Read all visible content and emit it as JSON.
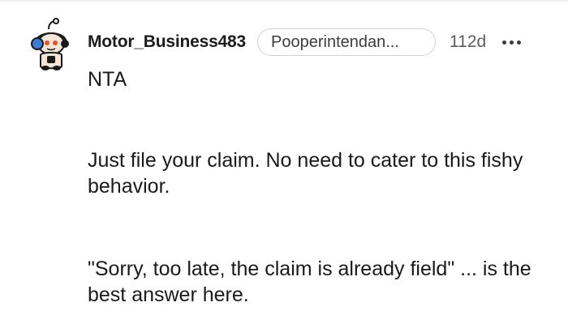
{
  "comment": {
    "username": "Motor_Business483",
    "flair": "Pooperintendan...",
    "age": "112d",
    "paragraphs": [
      "NTA",
      "Just file your claim. No need to cater to this fishy behavior.",
      "\"Sorry, too late, the claim is already field\" ... is the best answer here."
    ]
  },
  "icons": {
    "avatar": "snoo-avatar-icon",
    "more": "more-options-icon"
  },
  "colors": {
    "text": "#1a1a1b",
    "meta": "#5a5c5e",
    "flair_border": "#d0d3d6"
  }
}
